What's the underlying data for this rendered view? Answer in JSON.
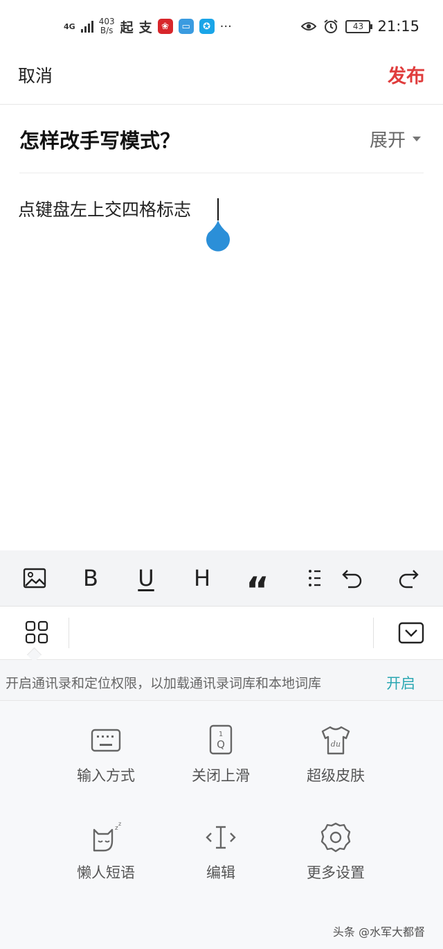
{
  "status_bar": {
    "network": "4G",
    "speed_value": "403",
    "speed_unit": "B/s",
    "app_glyph_1": "起",
    "app_glyph_2": "支",
    "more": "···",
    "battery": "43",
    "time": "21:15"
  },
  "top_bar": {
    "cancel_label": "取消",
    "publish_label": "发布"
  },
  "question": {
    "title": "怎样改手写模式？",
    "expand_label": "展开"
  },
  "editor": {
    "text": "点键盘左上交四格标志"
  },
  "format_toolbar": {
    "bold": "B",
    "underline": "U",
    "heading": "H",
    "quote": "“"
  },
  "keyboard": {
    "permission_text": "开启通讯录和定位权限，以加载通讯录词库和本地词库",
    "permission_action": "开启",
    "tiles": [
      {
        "label": "输入方式",
        "icon": "keyboard-icon"
      },
      {
        "label": "关闭上滑",
        "icon": "swipe-key-icon"
      },
      {
        "label": "超级皮肤",
        "icon": "skin-shirt-icon"
      },
      {
        "label": "懒人短语",
        "icon": "lazy-cat-icon"
      },
      {
        "label": "编辑",
        "icon": "text-cursor-icon"
      },
      {
        "label": "更多设置",
        "icon": "gear-icon"
      }
    ]
  },
  "watermark": "头条 @水军大都督",
  "colors": {
    "publish": "#e03c3c",
    "permission_action": "#2aa7b2",
    "cursor_handle": "#2b8fd8"
  }
}
